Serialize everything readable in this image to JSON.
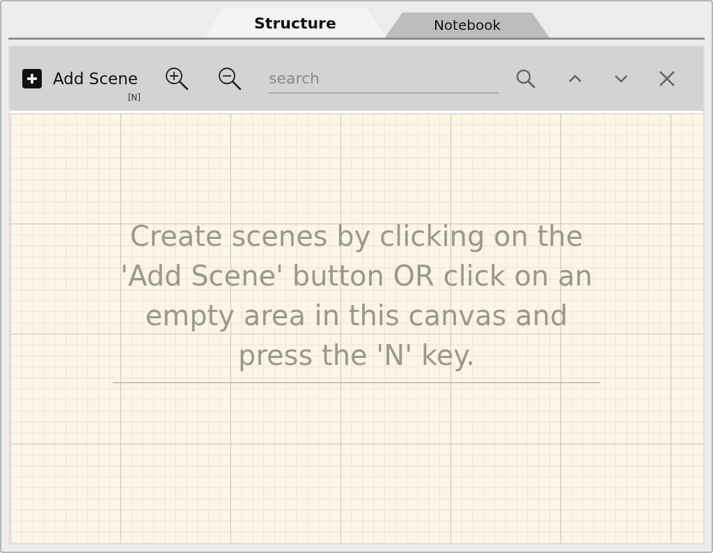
{
  "tabs": [
    {
      "label": "Structure",
      "selected": true
    },
    {
      "label": "Notebook",
      "selected": false
    }
  ],
  "toolbar": {
    "add_button": {
      "label": "Add Scene",
      "shortcut": "[N]"
    },
    "search": {
      "placeholder": "search"
    }
  },
  "canvas": {
    "hint": "Create scenes by clicking on the 'Add Scene' button OR click on an empty area in this canvas and press the 'N' key."
  }
}
